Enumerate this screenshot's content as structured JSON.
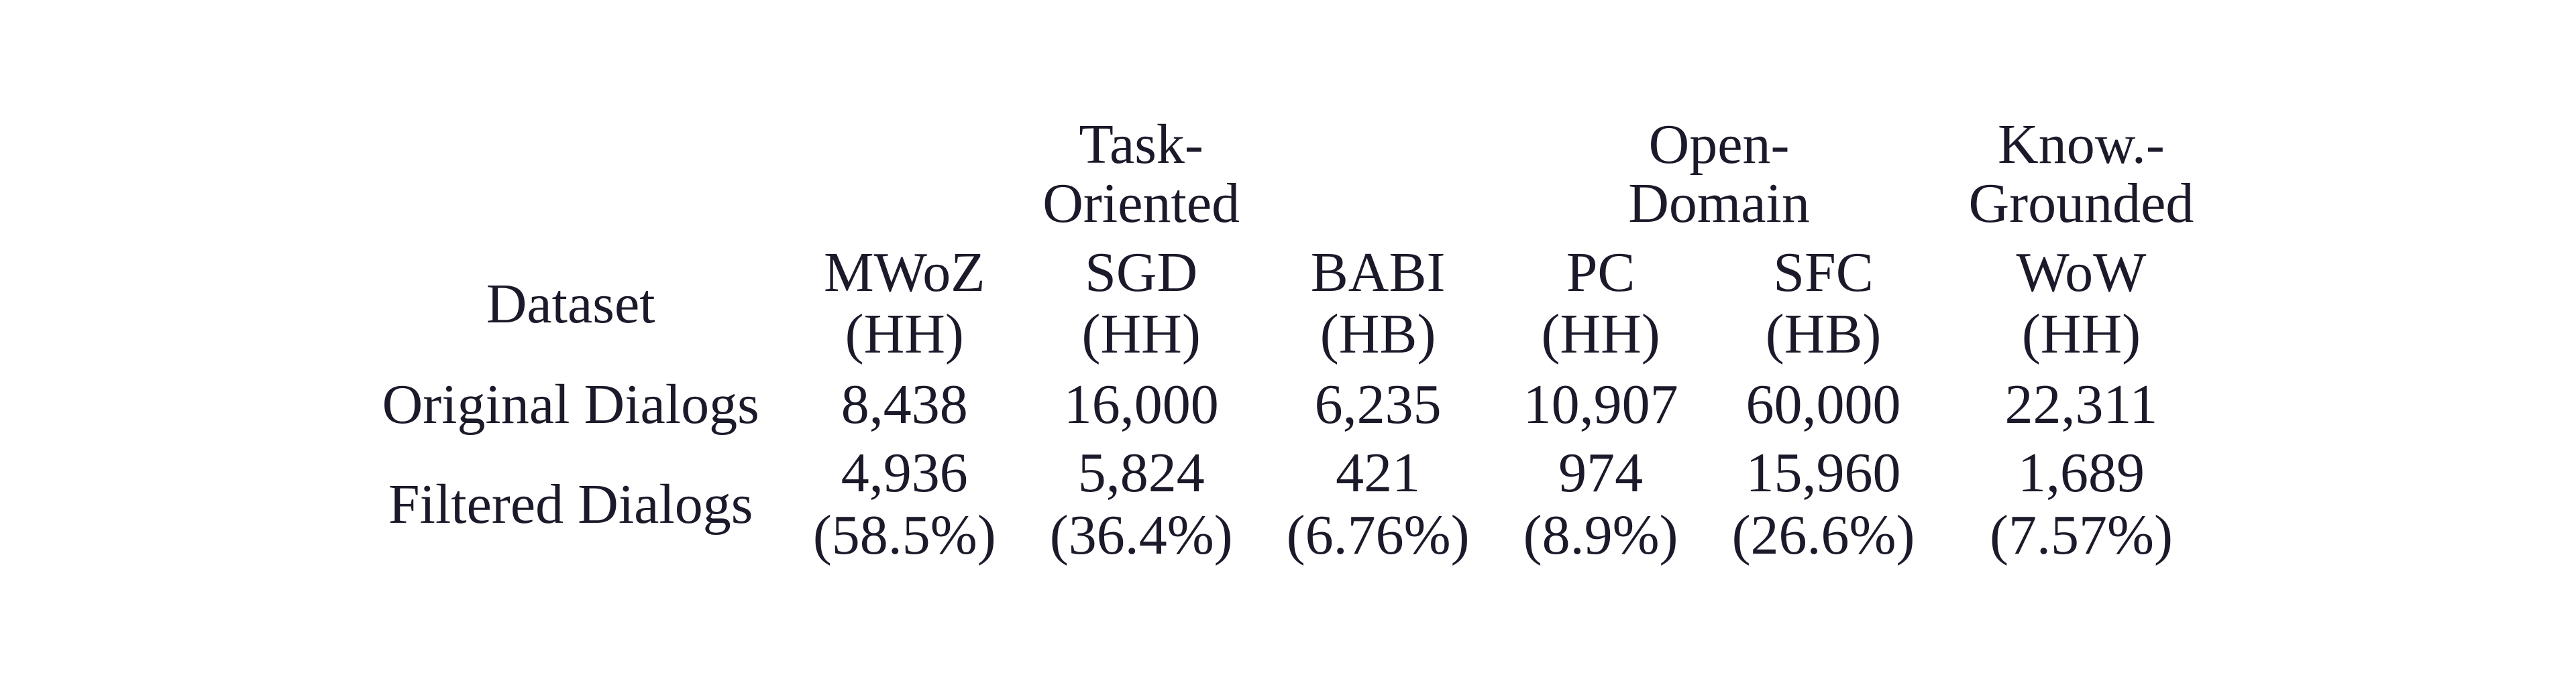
{
  "group_headers": {
    "g1_l1": "Task-",
    "g1_l2": "Oriented",
    "g2_l1": "Open-",
    "g2_l2": "Domain",
    "g3_l1": "Know.-",
    "g3_l2": "Grounded"
  },
  "row_labels": {
    "dataset": "Dataset",
    "original": "Original Dialogs",
    "filtered": "Filtered Dialogs"
  },
  "columns": {
    "c1_name": "MWoZ",
    "c1_mode": "(HH)",
    "c2_name": "SGD",
    "c2_mode": "(HH)",
    "c3_name": "BABI",
    "c3_mode": "(HB)",
    "c4_name": "PC",
    "c4_mode": "(HH)",
    "c5_name": "SFC",
    "c5_mode": "(HB)",
    "c6_name": "WoW",
    "c6_mode": "(HH)"
  },
  "original": {
    "c1": "8,438",
    "c2": "16,000",
    "c3": "6,235",
    "c4": "10,907",
    "c5": "60,000",
    "c6": "22,311"
  },
  "filtered": {
    "c1_n": "4,936",
    "c1_p": "(58.5%)",
    "c2_n": "5,824",
    "c2_p": "(36.4%)",
    "c3_n": "421",
    "c3_p": "(6.76%)",
    "c4_n": "974",
    "c4_p": "(8.9%)",
    "c5_n": "15,960",
    "c5_p": "(26.6%)",
    "c6_n": "1,689",
    "c6_p": "(7.57%)"
  },
  "chart_data": {
    "type": "table",
    "column_groups": [
      {
        "name": "Task-Oriented",
        "columns": [
          "MWoZ (HH)",
          "SGD (HH)",
          "BABI (HB)"
        ]
      },
      {
        "name": "Open-Domain",
        "columns": [
          "PC (HH)",
          "SFC (HB)"
        ]
      },
      {
        "name": "Know.-Grounded",
        "columns": [
          "WoW (HH)"
        ]
      }
    ],
    "rows": [
      {
        "label": "Original Dialogs",
        "values": [
          8438,
          16000,
          6235,
          10907,
          60000,
          22311
        ]
      },
      {
        "label": "Filtered Dialogs",
        "values": [
          4936,
          5824,
          421,
          974,
          15960,
          1689
        ],
        "percent": [
          58.5,
          36.4,
          6.76,
          8.9,
          26.6,
          7.57
        ]
      }
    ]
  }
}
